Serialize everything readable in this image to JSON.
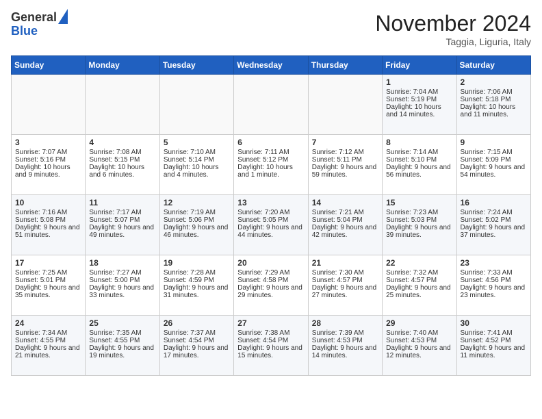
{
  "header": {
    "logo_general": "General",
    "logo_blue": "Blue",
    "month_title": "November 2024",
    "subtitle": "Taggia, Liguria, Italy"
  },
  "days_of_week": [
    "Sunday",
    "Monday",
    "Tuesday",
    "Wednesday",
    "Thursday",
    "Friday",
    "Saturday"
  ],
  "weeks": [
    [
      {
        "day": "",
        "info": ""
      },
      {
        "day": "",
        "info": ""
      },
      {
        "day": "",
        "info": ""
      },
      {
        "day": "",
        "info": ""
      },
      {
        "day": "",
        "info": ""
      },
      {
        "day": "1",
        "info": "Sunrise: 7:04 AM\nSunset: 5:19 PM\nDaylight: 10 hours and 14 minutes."
      },
      {
        "day": "2",
        "info": "Sunrise: 7:06 AM\nSunset: 5:18 PM\nDaylight: 10 hours and 11 minutes."
      }
    ],
    [
      {
        "day": "3",
        "info": "Sunrise: 7:07 AM\nSunset: 5:16 PM\nDaylight: 10 hours and 9 minutes."
      },
      {
        "day": "4",
        "info": "Sunrise: 7:08 AM\nSunset: 5:15 PM\nDaylight: 10 hours and 6 minutes."
      },
      {
        "day": "5",
        "info": "Sunrise: 7:10 AM\nSunset: 5:14 PM\nDaylight: 10 hours and 4 minutes."
      },
      {
        "day": "6",
        "info": "Sunrise: 7:11 AM\nSunset: 5:12 PM\nDaylight: 10 hours and 1 minute."
      },
      {
        "day": "7",
        "info": "Sunrise: 7:12 AM\nSunset: 5:11 PM\nDaylight: 9 hours and 59 minutes."
      },
      {
        "day": "8",
        "info": "Sunrise: 7:14 AM\nSunset: 5:10 PM\nDaylight: 9 hours and 56 minutes."
      },
      {
        "day": "9",
        "info": "Sunrise: 7:15 AM\nSunset: 5:09 PM\nDaylight: 9 hours and 54 minutes."
      }
    ],
    [
      {
        "day": "10",
        "info": "Sunrise: 7:16 AM\nSunset: 5:08 PM\nDaylight: 9 hours and 51 minutes."
      },
      {
        "day": "11",
        "info": "Sunrise: 7:17 AM\nSunset: 5:07 PM\nDaylight: 9 hours and 49 minutes."
      },
      {
        "day": "12",
        "info": "Sunrise: 7:19 AM\nSunset: 5:06 PM\nDaylight: 9 hours and 46 minutes."
      },
      {
        "day": "13",
        "info": "Sunrise: 7:20 AM\nSunset: 5:05 PM\nDaylight: 9 hours and 44 minutes."
      },
      {
        "day": "14",
        "info": "Sunrise: 7:21 AM\nSunset: 5:04 PM\nDaylight: 9 hours and 42 minutes."
      },
      {
        "day": "15",
        "info": "Sunrise: 7:23 AM\nSunset: 5:03 PM\nDaylight: 9 hours and 39 minutes."
      },
      {
        "day": "16",
        "info": "Sunrise: 7:24 AM\nSunset: 5:02 PM\nDaylight: 9 hours and 37 minutes."
      }
    ],
    [
      {
        "day": "17",
        "info": "Sunrise: 7:25 AM\nSunset: 5:01 PM\nDaylight: 9 hours and 35 minutes."
      },
      {
        "day": "18",
        "info": "Sunrise: 7:27 AM\nSunset: 5:00 PM\nDaylight: 9 hours and 33 minutes."
      },
      {
        "day": "19",
        "info": "Sunrise: 7:28 AM\nSunset: 4:59 PM\nDaylight: 9 hours and 31 minutes."
      },
      {
        "day": "20",
        "info": "Sunrise: 7:29 AM\nSunset: 4:58 PM\nDaylight: 9 hours and 29 minutes."
      },
      {
        "day": "21",
        "info": "Sunrise: 7:30 AM\nSunset: 4:57 PM\nDaylight: 9 hours and 27 minutes."
      },
      {
        "day": "22",
        "info": "Sunrise: 7:32 AM\nSunset: 4:57 PM\nDaylight: 9 hours and 25 minutes."
      },
      {
        "day": "23",
        "info": "Sunrise: 7:33 AM\nSunset: 4:56 PM\nDaylight: 9 hours and 23 minutes."
      }
    ],
    [
      {
        "day": "24",
        "info": "Sunrise: 7:34 AM\nSunset: 4:55 PM\nDaylight: 9 hours and 21 minutes."
      },
      {
        "day": "25",
        "info": "Sunrise: 7:35 AM\nSunset: 4:55 PM\nDaylight: 9 hours and 19 minutes."
      },
      {
        "day": "26",
        "info": "Sunrise: 7:37 AM\nSunset: 4:54 PM\nDaylight: 9 hours and 17 minutes."
      },
      {
        "day": "27",
        "info": "Sunrise: 7:38 AM\nSunset: 4:54 PM\nDaylight: 9 hours and 15 minutes."
      },
      {
        "day": "28",
        "info": "Sunrise: 7:39 AM\nSunset: 4:53 PM\nDaylight: 9 hours and 14 minutes."
      },
      {
        "day": "29",
        "info": "Sunrise: 7:40 AM\nSunset: 4:53 PM\nDaylight: 9 hours and 12 minutes."
      },
      {
        "day": "30",
        "info": "Sunrise: 7:41 AM\nSunset: 4:52 PM\nDaylight: 9 hours and 11 minutes."
      }
    ]
  ]
}
